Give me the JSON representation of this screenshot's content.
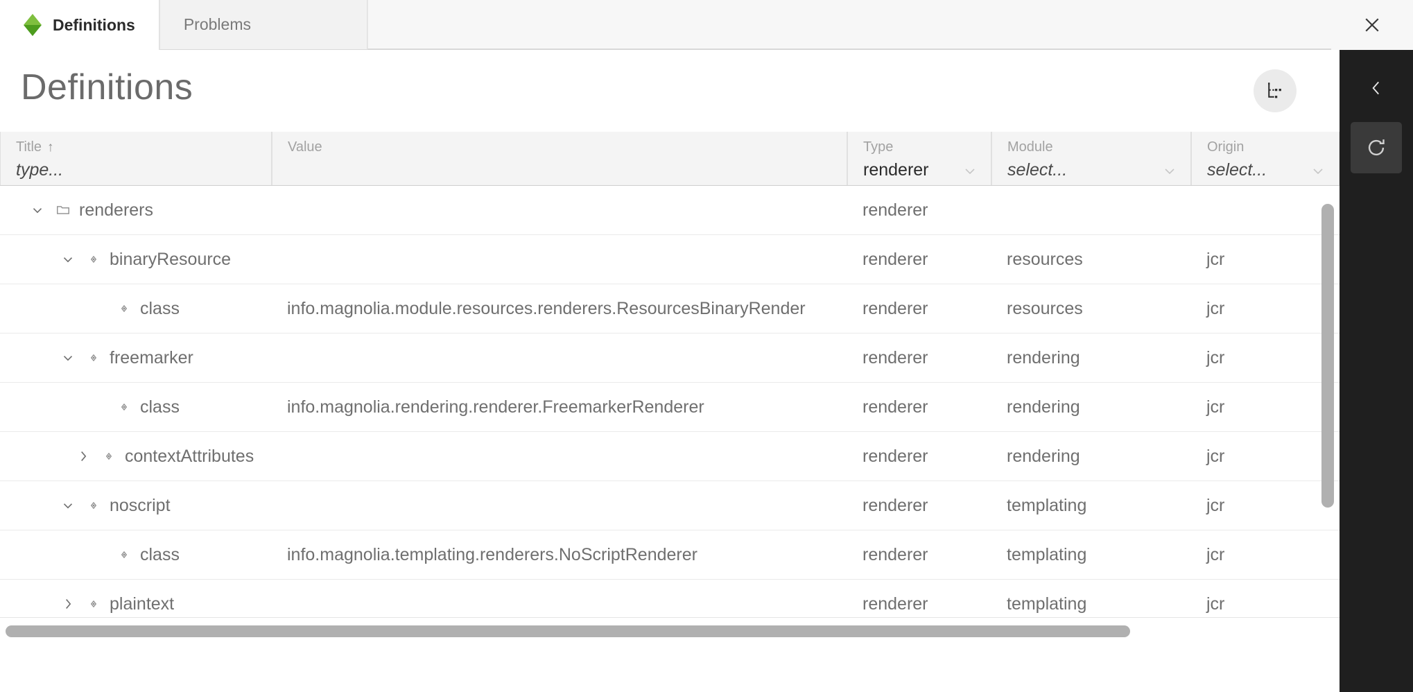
{
  "window": {
    "close_label": "×",
    "close_icon": "close-icon"
  },
  "tabs": [
    {
      "label": "Definitions",
      "active": true,
      "icon": "magnolia-logo-icon"
    },
    {
      "label": "Problems",
      "active": false,
      "icon": ""
    }
  ],
  "header": {
    "title": "Definitions",
    "tree_toggle_icon": "tree-structure-icon"
  },
  "table": {
    "columns": [
      {
        "key": "title",
        "label": "Title",
        "filter_type": "text",
        "value": "",
        "placeholder": "type...",
        "sorted": true,
        "sort_dir": "asc",
        "sort_glyph": "↑"
      },
      {
        "key": "value",
        "label": "Value",
        "filter_type": "none",
        "value": "",
        "placeholder": "",
        "sorted": false
      },
      {
        "key": "type",
        "label": "Type",
        "filter_type": "select",
        "value": "renderer",
        "placeholder": "select...",
        "sorted": false
      },
      {
        "key": "module",
        "label": "Module",
        "filter_type": "select",
        "value": "",
        "placeholder": "select...",
        "sorted": false
      },
      {
        "key": "origin",
        "label": "Origin",
        "filter_type": "select",
        "value": "",
        "placeholder": "select...",
        "sorted": false
      }
    ],
    "rows": [
      {
        "title": "renderers",
        "value": "",
        "type": "renderer",
        "module": "",
        "origin": "",
        "depth": 0,
        "icon": "folder-icon",
        "expander": "expanded"
      },
      {
        "title": "binaryResource",
        "value": "",
        "type": "renderer",
        "module": "resources",
        "origin": "jcr",
        "depth": 1,
        "icon": "node-icon",
        "expander": "expanded"
      },
      {
        "title": "class",
        "value": "info.magnolia.module.resources.renderers.ResourcesBinaryRender",
        "type": "renderer",
        "module": "resources",
        "origin": "jcr",
        "depth": 2,
        "icon": "node-icon",
        "expander": "none"
      },
      {
        "title": "freemarker",
        "value": "",
        "type": "renderer",
        "module": "rendering",
        "origin": "jcr",
        "depth": 1,
        "icon": "node-icon",
        "expander": "expanded"
      },
      {
        "title": "class",
        "value": "info.magnolia.rendering.renderer.FreemarkerRenderer",
        "type": "renderer",
        "module": "rendering",
        "origin": "jcr",
        "depth": 2,
        "icon": "node-icon",
        "expander": "none"
      },
      {
        "title": "contextAttributes",
        "value": "",
        "type": "renderer",
        "module": "rendering",
        "origin": "jcr",
        "depth": 1.5,
        "icon": "node-icon",
        "expander": "collapsed"
      },
      {
        "title": "noscript",
        "value": "",
        "type": "renderer",
        "module": "templating",
        "origin": "jcr",
        "depth": 1,
        "icon": "node-icon",
        "expander": "expanded"
      },
      {
        "title": "class",
        "value": "info.magnolia.templating.renderers.NoScriptRenderer",
        "type": "renderer",
        "module": "templating",
        "origin": "jcr",
        "depth": 2,
        "icon": "node-icon",
        "expander": "none"
      },
      {
        "title": "plaintext",
        "value": "",
        "type": "renderer",
        "module": "templating",
        "origin": "jcr",
        "depth": 1,
        "icon": "node-icon",
        "expander": "collapsed"
      }
    ]
  },
  "scrollbars": {
    "vertical": {
      "thumb_top_pct": 0,
      "thumb_height_pct": 70
    },
    "horizontal": {
      "thumb_left_pct": 0,
      "thumb_width_pct": 84
    }
  },
  "rail": {
    "back_icon": "chevron-left-icon",
    "refresh_icon": "refresh-icon"
  },
  "colors": {
    "brand_green_light": "#7fbf3f",
    "brand_green_dark": "#4d9c1e",
    "rail_bg": "#1f1f1f",
    "rail_button_bg": "#3a3a3a",
    "header_bg": "#f4f4f4",
    "text_muted": "#6f6f6f"
  }
}
